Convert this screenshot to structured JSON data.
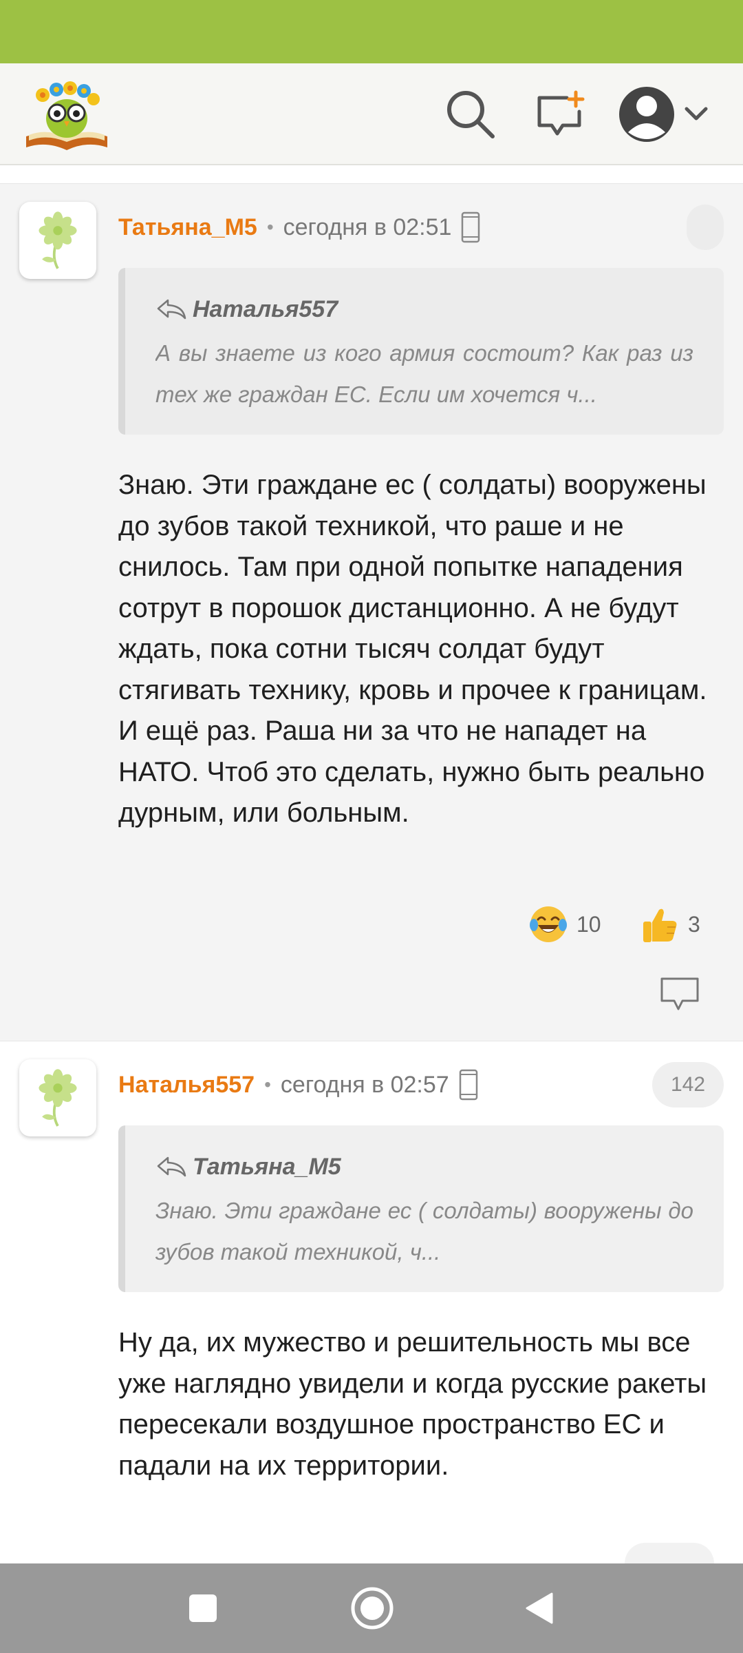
{
  "header": {
    "logo_icon": "owl-with-flowers-on-book-logo",
    "search_icon": "search-icon",
    "new_post_icon": "new-message-plus-icon",
    "profile_icon": "profile-avatar-icon",
    "menu_icon": "chevron-down-icon"
  },
  "comments": [
    {
      "author": "Татьяна_М5",
      "separator": "•",
      "time": "сегодня в 02:51",
      "device_icon": "mobile-phone-icon",
      "rating": "",
      "quote": {
        "author": "Наталья557",
        "text": "А вы знаете из кого армия состоит? Как раз из тех же граждан ЕС. Если им хочется ч..."
      },
      "text": "Знаю. Эти граждане ес ( солдаты) вооружены до зубов такой техникой, что раше и не снилось. Там при одной попытке нападения сотрут в порошок дистанционно. А не будут ждать, пока сотни тысяч солдат будут стягивать технику, кровь и прочее к границам.\nИ ещё раз. Раша ни за что не нападет на НАТО. Чтоб это сделать, нужно быть реально дурным, или больным.",
      "reactions": [
        {
          "icon": "laughing-tears-emoji",
          "count": "10"
        },
        {
          "icon": "thumbs-up-emoji",
          "count": "3"
        }
      ],
      "reply_icon": "comment-bubble-icon"
    },
    {
      "author": "Наталья557",
      "separator": "•",
      "time": "сегодня в 02:57",
      "device_icon": "mobile-phone-icon",
      "rating": "142",
      "quote": {
        "author": "Татьяна_М5",
        "text": "Знаю. Эти граждане ес ( солдаты) вооружены до зубов такой техникой, ч..."
      },
      "text": "Ну да, их мужество и решительность мы все уже наглядно увидели и когда русские ракеты пересекали воздушное пространство ЕС и падали на их территории."
    }
  ],
  "colors": {
    "status_bar": "#9dc144",
    "author": "#e97a13",
    "nav_bar": "#999999"
  },
  "nav": {
    "recent_icon": "square-recents-icon",
    "home_icon": "circle-home-icon",
    "back_icon": "triangle-back-icon"
  }
}
